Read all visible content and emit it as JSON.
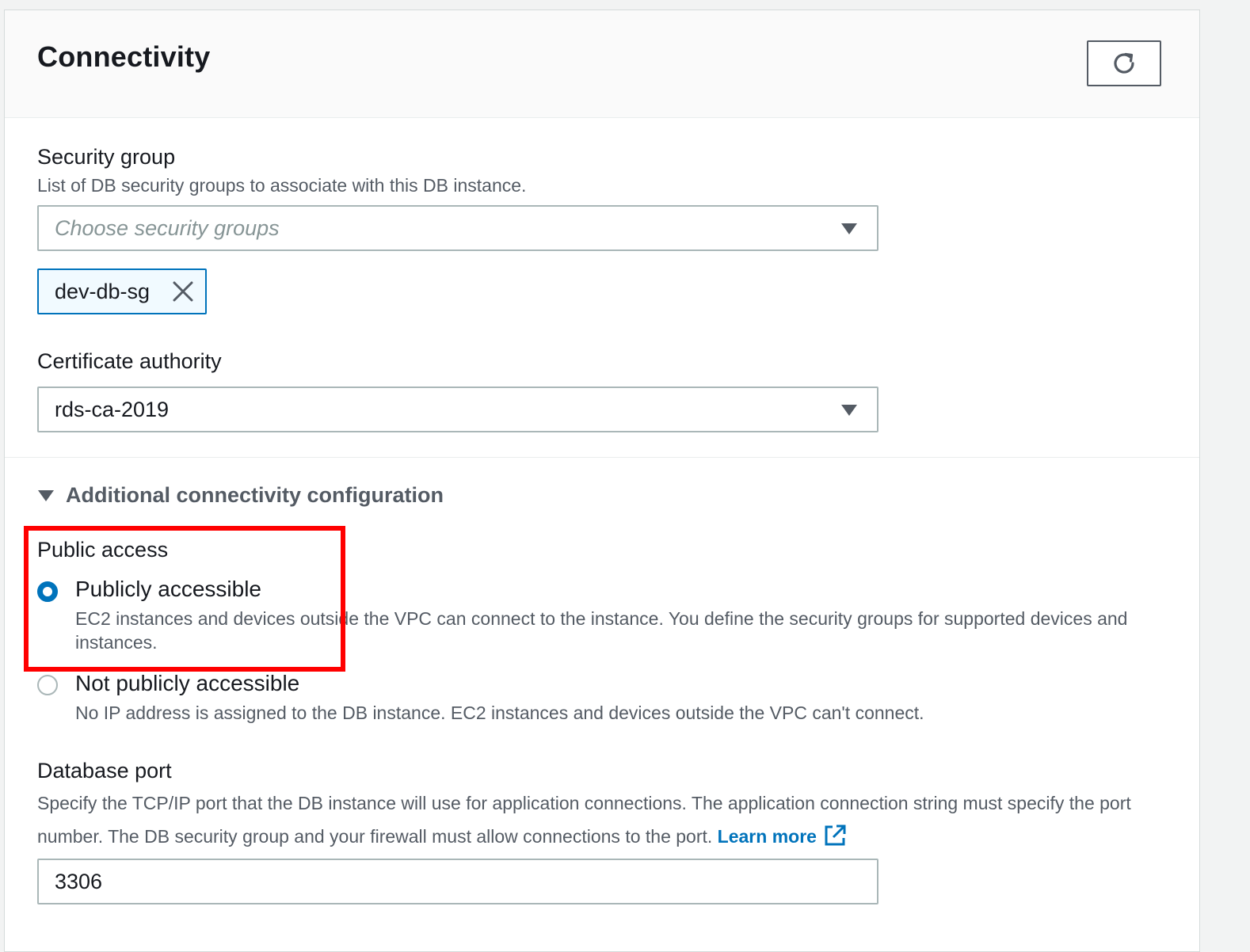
{
  "panel": {
    "title": "Connectivity",
    "refresh_icon": "refresh-icon"
  },
  "security_group": {
    "label": "Security group",
    "description": "List of DB security groups to associate with this DB instance.",
    "placeholder": "Choose security groups",
    "selected_tokens": [
      "dev-db-sg"
    ]
  },
  "certificate_authority": {
    "label": "Certificate authority",
    "value": "rds-ca-2019"
  },
  "additional": {
    "label": "Additional connectivity configuration",
    "expanded": true
  },
  "public_access": {
    "label": "Public access",
    "options": [
      {
        "label": "Publicly accessible",
        "description": "EC2 instances and devices outside the VPC can connect to the instance. You define the security groups for supported devices and instances.",
        "selected": true
      },
      {
        "label": "Not publicly accessible",
        "description": "No IP address is assigned to the DB instance. EC2 instances and devices outside the VPC can't connect.",
        "selected": false
      }
    ]
  },
  "database_port": {
    "label": "Database port",
    "description": "Specify the TCP/IP port that the DB instance will use for application connections. The application connection string must specify the port number. The DB security group and your firewall must allow connections to the port.",
    "learn_more": "Learn more",
    "value": "3306"
  },
  "colors": {
    "accent": "#0073bb",
    "highlight": "#ff0000",
    "text": "#16191f",
    "secondary_text": "#545b64"
  }
}
